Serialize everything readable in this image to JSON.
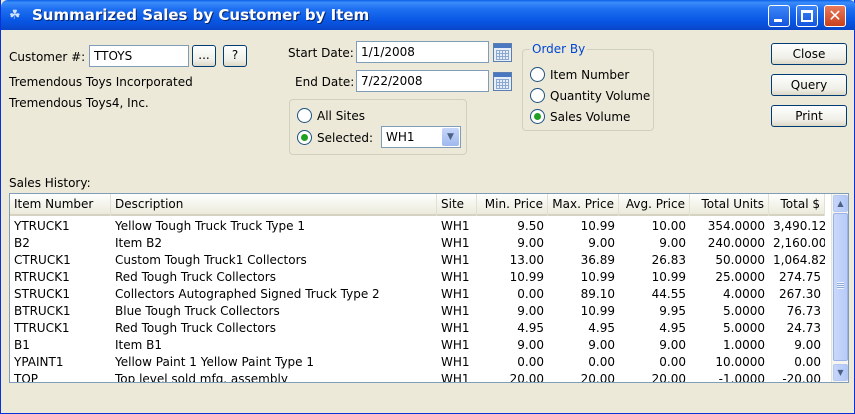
{
  "window": {
    "title": "Summarized Sales by Customer by Item"
  },
  "customer": {
    "label": "Customer #:",
    "value": "TTOYS",
    "lookup_label": "...",
    "help_label": "?",
    "name": "Tremendous Toys Incorporated",
    "name2": "Tremendous Toys4, Inc."
  },
  "dates": {
    "start_label": "Start Date:",
    "start_value": "1/1/2008",
    "end_label": "End Date:",
    "end_value": "7/22/2008"
  },
  "sites": {
    "all_label": "All Sites",
    "selected_label": "Selected:",
    "selected_value": "WH1",
    "selected_mode": "selected"
  },
  "order_by": {
    "title": "Order By",
    "options": [
      "Item Number",
      "Quantity Volume",
      "Sales Volume"
    ],
    "selected": "Sales Volume"
  },
  "actions": {
    "close": "Close",
    "query": "Query",
    "print": "Print"
  },
  "sales_history": {
    "label": "Sales History:",
    "columns": [
      "Item Number",
      "Description",
      "Site",
      "Min. Price",
      "Max. Price",
      "Avg. Price",
      "Total Units",
      "Total $"
    ],
    "rows": [
      [
        "YTRUCK1",
        "Yellow Tough Truck Truck Type 1",
        "WH1",
        "9.50",
        "10.99",
        "10.00",
        "354.0000",
        "3,490.12"
      ],
      [
        "B2",
        "Item B2",
        "WH1",
        "9.00",
        "9.00",
        "9.00",
        "240.0000",
        "2,160.00"
      ],
      [
        "CTRUCK1",
        "Custom Tough Truck1 Collectors",
        "WH1",
        "13.00",
        "36.89",
        "26.83",
        "50.0000",
        "1,064.82"
      ],
      [
        "RTRUCK1",
        "Red Tough Truck Collectors",
        "WH1",
        "10.99",
        "10.99",
        "10.99",
        "25.0000",
        "274.75"
      ],
      [
        "STRUCK1",
        "Collectors Autographed Signed Truck Type 2",
        "WH1",
        "0.00",
        "89.10",
        "44.55",
        "4.0000",
        "267.30"
      ],
      [
        "BTRUCK1",
        "Blue Tough Truck Collectors",
        "WH1",
        "9.00",
        "10.99",
        "9.95",
        "5.0000",
        "76.73"
      ],
      [
        "TTRUCK1",
        "Red Tough Truck Collectors",
        "WH1",
        "4.95",
        "4.95",
        "4.95",
        "5.0000",
        "24.73"
      ],
      [
        "B1",
        "Item B1",
        "WH1",
        "9.00",
        "9.00",
        "9.00",
        "1.0000",
        "9.00"
      ],
      [
        "YPAINT1",
        "Yellow Paint 1  Yellow Paint Type 1",
        "WH1",
        "0.00",
        "0.00",
        "0.00",
        "10.0000",
        "0.00"
      ],
      [
        "TOP",
        "Top level sold mfg. assembly",
        "WH1",
        "20.00",
        "20.00",
        "20.00",
        "-1.0000",
        "-20.00"
      ]
    ]
  },
  "icons": {
    "app": "app-icon",
    "calendar": "calendar-icon"
  }
}
